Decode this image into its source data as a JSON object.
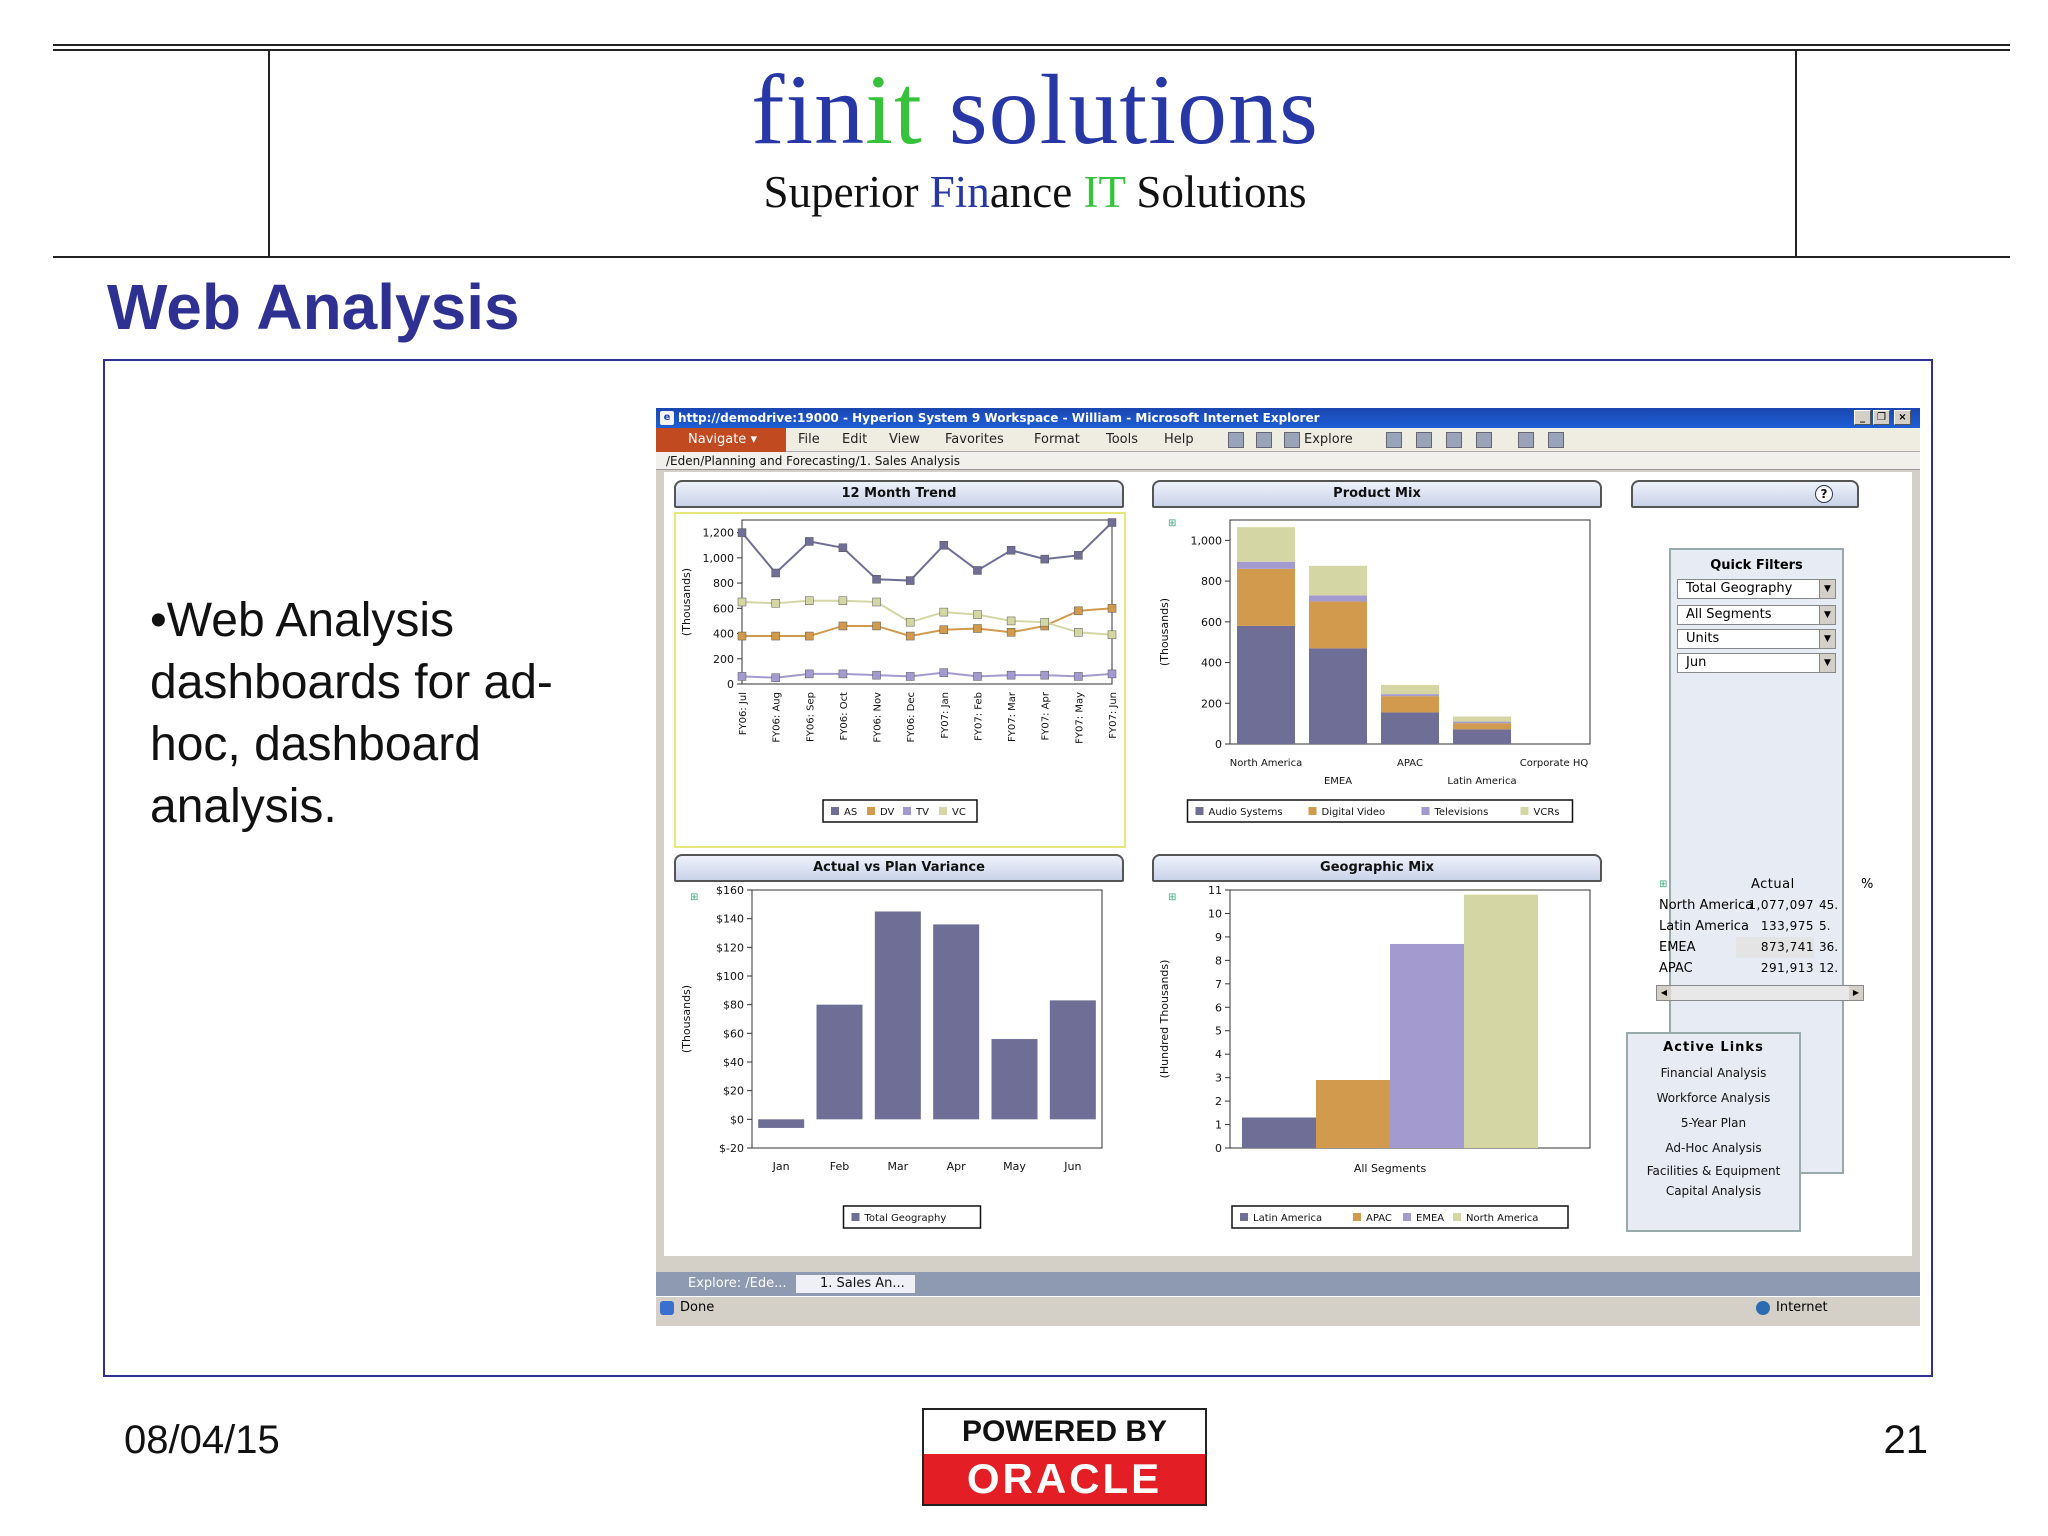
{
  "header": {
    "logo_part1": "fin",
    "logo_part2": "it",
    "logo_part3": " solutions",
    "tag_part1": "Superior ",
    "tag_part2": "Fin",
    "tag_part3": "ance ",
    "tag_part4": "IT",
    "tag_part5": " Solutions"
  },
  "slide": {
    "title": "Web Analysis",
    "bullet": "•Web Analysis dashboards for ad-hoc, dashboard analysis."
  },
  "footer": {
    "date": "08/04/15",
    "page": "21",
    "powered_by": "POWERED BY",
    "oracle": "ORACLE"
  },
  "browser": {
    "title": "http://demodrive:19000 - Hyperion System 9 Workspace - William - Microsoft Internet Explorer",
    "navigate": "Navigate",
    "menu": [
      "File",
      "Edit",
      "View",
      "Favorites",
      "Format",
      "Tools",
      "Help"
    ],
    "explore": "Explore",
    "path": "/Eden/Planning and Forecasting/1. Sales Analysis",
    "tab1": "Explore: /Ede...",
    "tab2": "1. Sales An...",
    "status": "Done",
    "zone": "Internet"
  },
  "sidebar": {
    "quick_filters_title": "Quick Filters",
    "filters": [
      "Total Geography",
      "All Segments",
      "Units",
      "Jun"
    ],
    "grid_header_actual": "Actual",
    "grid_header_pct": "%",
    "grid_rows": [
      {
        "name": "North America",
        "value": "1,077,097",
        "pct": "45."
      },
      {
        "name": "Latin America",
        "value": "133,975",
        "pct": "5."
      },
      {
        "name": "EMEA",
        "value": "873,741",
        "pct": "36."
      },
      {
        "name": "APAC",
        "value": "291,913",
        "pct": "12."
      }
    ],
    "active_links_title": "Active Links",
    "links": [
      "Financial Analysis",
      "Workforce Analysis",
      "5-Year Plan",
      "Ad-Hoc Analysis",
      "Facilities & Equipment",
      "Capital Analysis"
    ]
  },
  "chart_data": [
    {
      "type": "line",
      "title": "12 Month Trend",
      "ylabel": "(Thousands)",
      "ylim": [
        0,
        1300
      ],
      "yticks": [
        "0",
        "200",
        "400",
        "600",
        "800",
        "1,000",
        "1,200"
      ],
      "categories": [
        "FY06: Jul",
        "FY06: Aug",
        "FY06: Sep",
        "FY06: Oct",
        "FY06: Nov",
        "FY06: Dec",
        "FY07: Jan",
        "FY07: Feb",
        "FY07: Mar",
        "FY07: Apr",
        "FY07: May",
        "FY07: Jun"
      ],
      "series": [
        {
          "name": "AS",
          "color": "#6e6e96",
          "values": [
            1200,
            880,
            1130,
            1080,
            830,
            820,
            1100,
            900,
            1060,
            990,
            1020,
            1280
          ]
        },
        {
          "name": "DV",
          "color": "#d29a4c",
          "values": [
            380,
            380,
            380,
            460,
            460,
            380,
            430,
            440,
            410,
            460,
            580,
            600
          ]
        },
        {
          "name": "TV",
          "color": "#a39bd0",
          "values": [
            60,
            50,
            80,
            80,
            70,
            60,
            90,
            60,
            70,
            70,
            60,
            80
          ]
        },
        {
          "name": "VC",
          "color": "#d4d7a4",
          "values": [
            650,
            640,
            660,
            660,
            650,
            490,
            570,
            550,
            500,
            490,
            410,
            390
          ]
        }
      ]
    },
    {
      "type": "bar",
      "stacked": true,
      "title": "Product Mix",
      "ylabel": "(Thousands)",
      "ylim": [
        0,
        1100
      ],
      "yticks": [
        "0",
        "200",
        "400",
        "600",
        "800",
        "1,000"
      ],
      "categories": [
        "North America",
        "EMEA",
        "APAC",
        "Latin America",
        "Corporate HQ"
      ],
      "series": [
        {
          "name": "Audio Systems",
          "color": "#6e6e96",
          "values": [
            580,
            470,
            155,
            72,
            0
          ]
        },
        {
          "name": "Digital Video",
          "color": "#d29a4c",
          "values": [
            280,
            230,
            80,
            30,
            0
          ]
        },
        {
          "name": "Televisions",
          "color": "#a39bd0",
          "values": [
            35,
            30,
            10,
            8,
            0
          ]
        },
        {
          "name": "VCRs",
          "color": "#d4d7a4",
          "values": [
            170,
            145,
            45,
            25,
            0
          ]
        }
      ]
    },
    {
      "type": "bar",
      "title": "Actual vs Plan Variance",
      "ylabel": "(Thousands)",
      "ylim": [
        -20,
        160
      ],
      "yticks": [
        "$-20",
        "$0",
        "$20",
        "$40",
        "$60",
        "$80",
        "$100",
        "$120",
        "$140",
        "$160"
      ],
      "categories": [
        "Jan",
        "Feb",
        "Mar",
        "Apr",
        "May",
        "Jun"
      ],
      "series": [
        {
          "name": "Total Geography",
          "color": "#6e6e96",
          "values": [
            -6,
            80,
            145,
            136,
            56,
            83
          ]
        }
      ]
    },
    {
      "type": "bar",
      "title": "Geographic Mix",
      "ylabel": "(Hundred Thousands)",
      "ylim": [
        0,
        11
      ],
      "yticks": [
        "0",
        "1",
        "2",
        "3",
        "4",
        "5",
        "6",
        "7",
        "8",
        "9",
        "10",
        "11"
      ],
      "categories": [
        "All Segments"
      ],
      "series": [
        {
          "name": "Latin America",
          "color": "#6e6e96",
          "values": [
            1.3
          ]
        },
        {
          "name": "APAC",
          "color": "#d29a4c",
          "values": [
            2.9
          ]
        },
        {
          "name": "EMEA",
          "color": "#a39bd0",
          "values": [
            8.7
          ]
        },
        {
          "name": "North America",
          "color": "#d4d7a4",
          "values": [
            10.8
          ]
        }
      ]
    }
  ]
}
